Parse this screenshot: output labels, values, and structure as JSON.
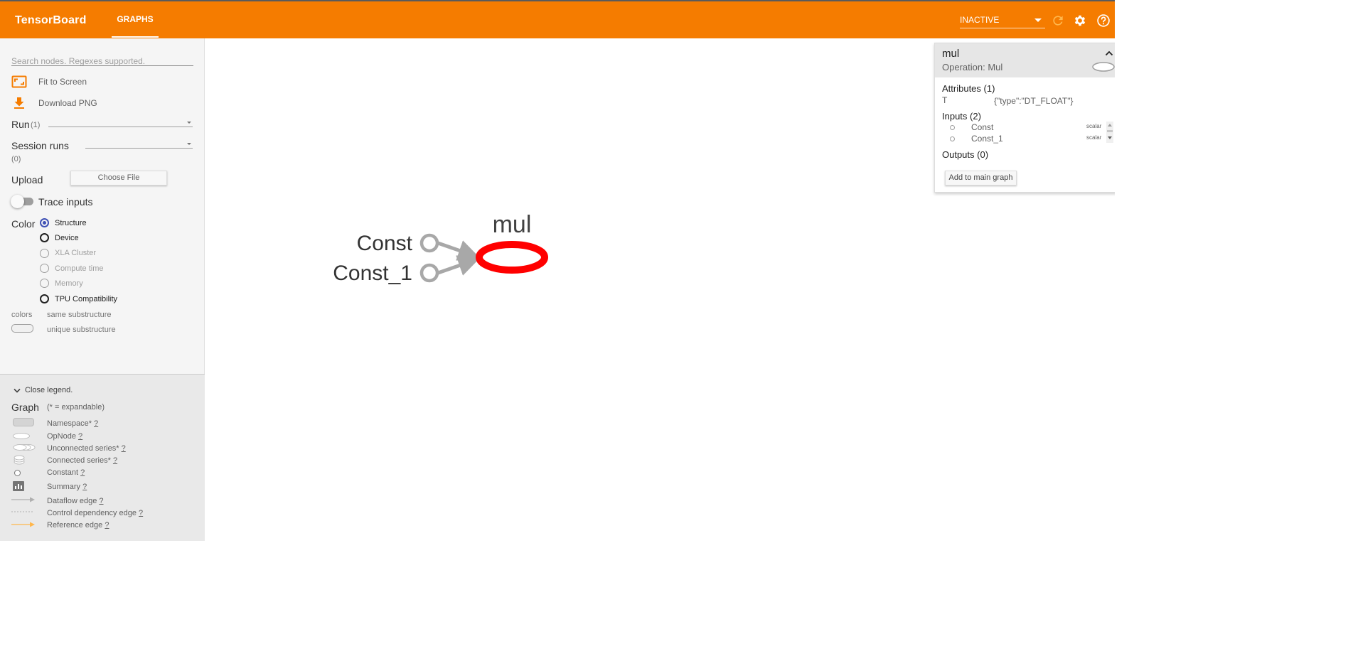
{
  "header": {
    "brand": "TensorBoard",
    "tab_graphs": "GRAPHS",
    "run_status": "INACTIVE",
    "icons": [
      "refresh-icon",
      "settings-icon",
      "help-icon"
    ]
  },
  "sidebar": {
    "search_placeholder": "Search nodes. Regexes supported.",
    "fit_to_screen": "Fit to Screen",
    "download_png": "Download PNG",
    "run_label": "Run",
    "run_count": "(1)",
    "session_runs_label": "Session runs",
    "session_runs_count": "(0)",
    "upload_label": "Upload",
    "choose_file": "Choose File",
    "trace_inputs": "Trace inputs",
    "color_label": "Color",
    "color_options": [
      "Structure",
      "Device",
      "XLA Cluster",
      "Compute time",
      "Memory",
      "TPU Compatibility"
    ],
    "color_selected": "Structure",
    "colors_label": "colors",
    "same_substructure": "same substructure",
    "unique_substructure": "unique substructure"
  },
  "legend": {
    "close_label": "Close legend.",
    "graph_label": "Graph",
    "expandable_note": "(* = expandable)",
    "items": [
      {
        "label": "Namespace*",
        "help": "?"
      },
      {
        "label": "OpNode",
        "help": "?"
      },
      {
        "label": "Unconnected series*",
        "help": "?"
      },
      {
        "label": "Connected series*",
        "help": "?"
      },
      {
        "label": "Constant",
        "help": "?"
      },
      {
        "label": "Summary",
        "help": "?"
      },
      {
        "label": "Dataflow edge",
        "help": "?"
      },
      {
        "label": "Control dependency edge",
        "help": "?"
      },
      {
        "label": "Reference edge",
        "help": "?"
      }
    ]
  },
  "graph": {
    "nodes": [
      {
        "name": "Const",
        "kind": "constant"
      },
      {
        "name": "Const_1",
        "kind": "constant"
      },
      {
        "name": "mul",
        "kind": "op",
        "selected": true
      }
    ],
    "edges": [
      {
        "from": "Const",
        "to": "mul"
      },
      {
        "from": "Const_1",
        "to": "mul"
      }
    ],
    "colors": {
      "selected": "#ff0000",
      "constant": "#aaaaaa",
      "edge": "#a8a8a8",
      "accent": "#f57c00"
    }
  },
  "info_card": {
    "title": "mul",
    "operation": "Operation: Mul",
    "attributes_header": "Attributes (1)",
    "attributes": [
      {
        "key": "T",
        "value": "{\"type\":\"DT_FLOAT\"}"
      }
    ],
    "inputs_header": "Inputs (2)",
    "inputs": [
      {
        "name": "Const",
        "shape": "scalar"
      },
      {
        "name": "Const_1",
        "shape": "scalar"
      }
    ],
    "outputs_header": "Outputs (0)",
    "add_button": "Add to main graph"
  }
}
